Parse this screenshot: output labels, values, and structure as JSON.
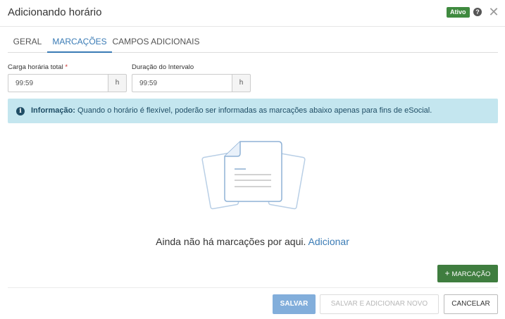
{
  "header": {
    "title": "Adicionando horário",
    "status_badge": "Ativo",
    "help_icon": "question-circle-icon",
    "close_icon": "close-icon"
  },
  "tabs": [
    {
      "label": "GERAL",
      "active": false
    },
    {
      "label": "MARCAÇÕES",
      "active": true
    },
    {
      "label": "CAMPOS ADICIONAIS",
      "active": false
    }
  ],
  "fields": {
    "carga": {
      "label": "Carga horária total",
      "required_mark": "*",
      "value": "99:59",
      "addon": "h"
    },
    "intervalo": {
      "label": "Duração do Intervalo",
      "value": "99:59",
      "addon": "h"
    }
  },
  "info": {
    "icon": "info-circle-icon",
    "label": "Informação:",
    "text": "Quando o horário é flexível, poderão ser informadas as marcações abaixo apenas para fins de eSocial."
  },
  "empty_state": {
    "icon": "documents-illustration-icon",
    "message": "Ainda não há marcações por aqui.",
    "link": "Adicionar"
  },
  "actions": {
    "add_marcacao": "MARCAÇÃO",
    "add_icon": "plus-icon",
    "save": "SALVAR",
    "save_and_new": "SALVAR E ADICIONAR NOVO",
    "cancel": "CANCELAR"
  },
  "colors": {
    "primary": "#3a7bb5",
    "success": "#3f7d3f",
    "info_bg": "#c4e6ef",
    "info_text": "#1f4d65"
  }
}
